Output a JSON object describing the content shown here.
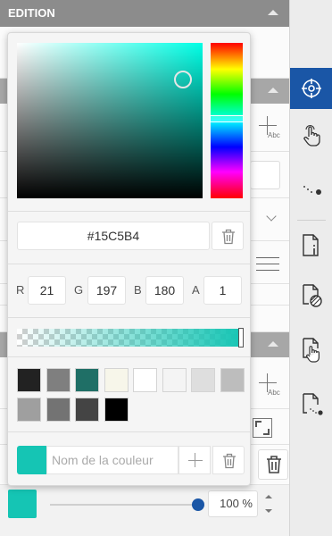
{
  "editor": {
    "title": "EDITION",
    "opacity_value": "100 %",
    "opacity_level": 1.0
  },
  "picker": {
    "hex": "#15C5B4",
    "channels": [
      {
        "label": "R",
        "value": "21"
      },
      {
        "label": "G",
        "value": "197"
      },
      {
        "label": "B",
        "value": "180"
      },
      {
        "label": "A",
        "value": "1"
      }
    ],
    "swatches": [
      "#222222",
      "#7f7f7f",
      "#1f6f66",
      "#f7f6ea",
      "#ffffff",
      "#f4f4f4",
      "#dedede",
      "#bdbdbd",
      "#9f9f9f",
      "#737373",
      "#444444",
      "#000000"
    ],
    "name_placeholder": "Nom de la couleur"
  },
  "colors": {
    "accent": "#1a56a6",
    "current_color": "#15c5b4"
  },
  "toolbar": {
    "tools": [
      "target-icon",
      "touch-icon",
      "path-icon",
      "document-info-icon",
      "document-hatch-icon",
      "document-touch-icon",
      "document-path-icon"
    ],
    "active": "target-icon"
  }
}
